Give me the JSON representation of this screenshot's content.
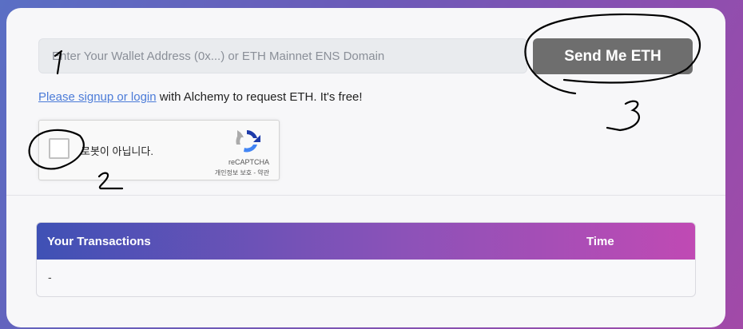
{
  "faucet_form": {
    "wallet_input": {
      "value": "",
      "placeholder": "Enter Your Wallet Address (0x...) or ETH Mainnet ENS Domain"
    },
    "send_button_label": "Send Me ETH",
    "signup": {
      "link_text": "Please signup or login",
      "suffix_text": " with Alchemy to request ETH. It's free!"
    }
  },
  "recaptcha": {
    "label": "로봇이 아닙니다.",
    "brand": "reCAPTCHA",
    "links": "개인정보 보호 - 약관"
  },
  "transactions": {
    "header_transactions": "Your Transactions",
    "header_time": "Time",
    "empty_row": "-"
  },
  "annotations": {
    "marks": [
      "1",
      "2",
      "3"
    ],
    "color": "#000000"
  },
  "colors": {
    "send_button": "#6e6e6e",
    "link": "#4b7bd8",
    "header_gradient_start": "#3f51b5",
    "header_gradient_end": "#c04ab4"
  }
}
